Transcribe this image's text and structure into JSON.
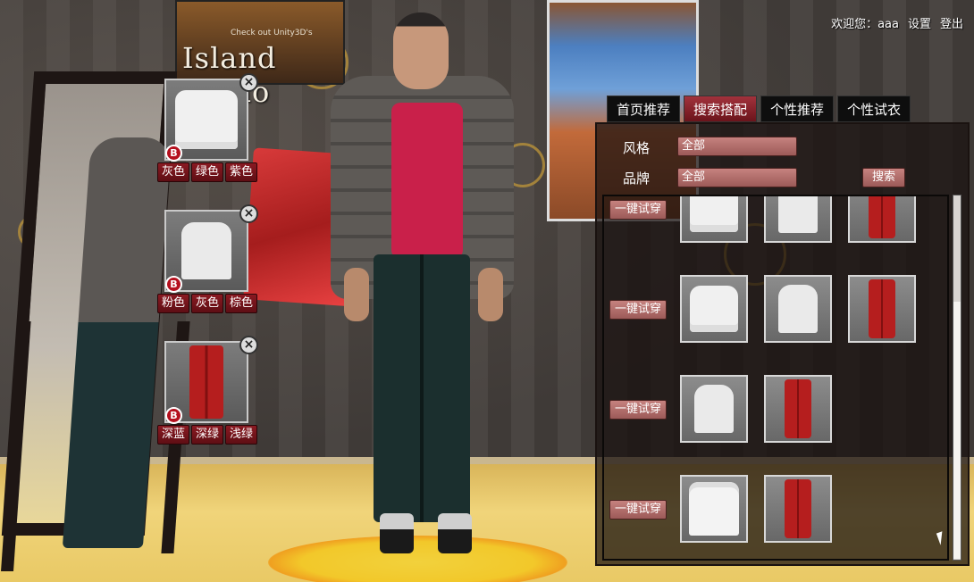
{
  "user_bar": {
    "welcome": "欢迎您：aaa",
    "settings": "设置",
    "logout": "登出"
  },
  "scene": {
    "poster_small": "Check out Unity3D's",
    "poster_title": "Island Demo"
  },
  "outfit_slots": [
    {
      "item": "white-puffer-jacket-icon",
      "badge": "B",
      "colors": [
        "灰色",
        "绿色",
        "紫色"
      ]
    },
    {
      "item": "white-tshirt-icon",
      "badge": "B",
      "colors": [
        "粉色",
        "灰色",
        "棕色"
      ]
    },
    {
      "item": "red-pants-icon",
      "badge": "B",
      "colors": [
        "深蓝",
        "深绿",
        "浅绿"
      ]
    }
  ],
  "tabs": [
    {
      "label": "首页推荐",
      "active": false
    },
    {
      "label": "搜索搭配",
      "active": true
    },
    {
      "label": "个性推荐",
      "active": false
    },
    {
      "label": "个性试衣",
      "active": false
    }
  ],
  "filters": {
    "style_label": "风格",
    "style_value": "全部",
    "brand_label": "品牌",
    "brand_value": "全部",
    "search_button": "搜索"
  },
  "results": [
    {
      "try_label": "一键试穿",
      "items": [
        "white-puffer-jacket-icon",
        "white-tshirt-icon",
        "red-pants-icon"
      ]
    },
    {
      "try_label": "一键试穿",
      "items": [
        "white-puffer-jacket-icon",
        "white-tshirt-icon",
        "red-pants-icon"
      ]
    },
    {
      "try_label": "一键试穿",
      "items": [
        "white-tshirt-icon",
        "red-pants-icon"
      ]
    },
    {
      "try_label": "一键试穿",
      "items": [
        "white-dress-shirt-icon",
        "red-pants-icon"
      ]
    }
  ],
  "colors": {
    "accent_red": "#8a1a22",
    "button_pink": "#c6827f",
    "tab_active": "#a2323c"
  }
}
